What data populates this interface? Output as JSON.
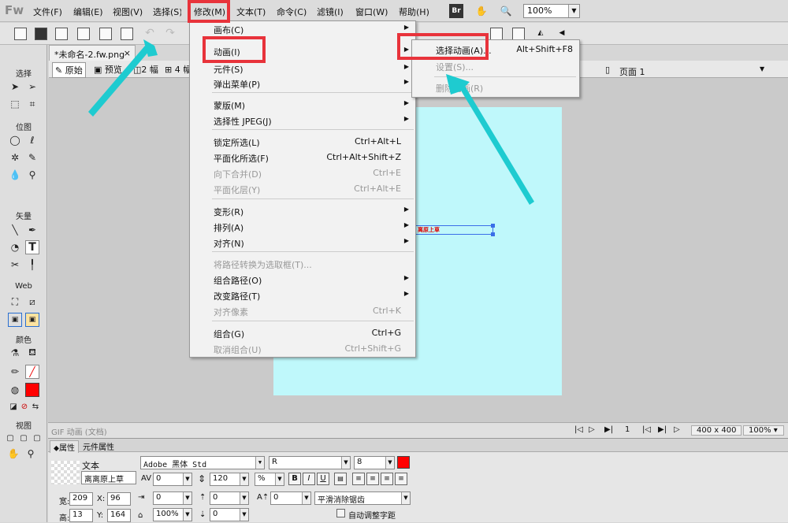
{
  "app": {
    "logo": "Fw"
  },
  "menubar": {
    "items": [
      "文件(F)",
      "编辑(E)",
      "视图(V)",
      "选择(S)",
      "修改(M)",
      "文本(T)",
      "命令(C)",
      "滤镜(I)",
      "窗口(W)",
      "帮助(H)"
    ],
    "br_label": "Br",
    "zoom": "100%"
  },
  "document": {
    "tab_title": "*未命名-2.fw.png",
    "tab_close": "×",
    "view_tabs": [
      "原始",
      "预览",
      "2 幅",
      "4 幅"
    ],
    "page_label": "页面 1",
    "canvas_text": "离原上草"
  },
  "tools": {
    "groups": [
      "选择",
      "位图",
      "矢量",
      "Web",
      "颜色",
      "视图"
    ]
  },
  "modify_menu": {
    "items": [
      {
        "label": "画布(C)",
        "shortcut": "",
        "submenu": true,
        "disabled": false
      },
      {
        "label": "动画(I)",
        "shortcut": "",
        "submenu": true,
        "disabled": false
      },
      {
        "label": "元件(S)",
        "shortcut": "",
        "submenu": true,
        "disabled": false
      },
      {
        "label": "弹出菜单(P)",
        "shortcut": "",
        "submenu": true,
        "disabled": false
      },
      {
        "label": "蒙版(M)",
        "shortcut": "",
        "submenu": true,
        "disabled": false
      },
      {
        "label": "选择性 JPEG(J)",
        "shortcut": "",
        "submenu": true,
        "disabled": false
      },
      {
        "label": "锁定所选(L)",
        "shortcut": "Ctrl+Alt+L",
        "submenu": false,
        "disabled": false
      },
      {
        "label": "平面化所选(F)",
        "shortcut": "Ctrl+Alt+Shift+Z",
        "submenu": false,
        "disabled": false
      },
      {
        "label": "向下合并(D)",
        "shortcut": "Ctrl+E",
        "submenu": false,
        "disabled": true
      },
      {
        "label": "平面化层(Y)",
        "shortcut": "Ctrl+Alt+E",
        "submenu": false,
        "disabled": true
      },
      {
        "label": "变形(R)",
        "shortcut": "",
        "submenu": true,
        "disabled": false
      },
      {
        "label": "排列(A)",
        "shortcut": "",
        "submenu": true,
        "disabled": false
      },
      {
        "label": "对齐(N)",
        "shortcut": "",
        "submenu": true,
        "disabled": false
      },
      {
        "label": "将路径转换为选取框(T)...",
        "shortcut": "",
        "submenu": false,
        "disabled": true
      },
      {
        "label": "组合路径(O)",
        "shortcut": "",
        "submenu": true,
        "disabled": false
      },
      {
        "label": "改变路径(T)",
        "shortcut": "",
        "submenu": true,
        "disabled": false
      },
      {
        "label": "对齐像素",
        "shortcut": "Ctrl+K",
        "submenu": false,
        "disabled": true
      },
      {
        "label": "组合(G)",
        "shortcut": "Ctrl+G",
        "submenu": false,
        "disabled": false
      },
      {
        "label": "取消组合(U)",
        "shortcut": "Ctrl+Shift+G",
        "submenu": false,
        "disabled": true
      }
    ]
  },
  "animation_menu": {
    "items": [
      {
        "label": "选择动画(A)...",
        "shortcut": "Alt+Shift+F8",
        "disabled": false
      },
      {
        "label": "设置(S)...",
        "shortcut": "",
        "disabled": true
      },
      {
        "label": "删除动画(R)",
        "shortcut": "",
        "disabled": true
      }
    ]
  },
  "status": {
    "mode": "GIF 动画 (文档)",
    "frame": "1",
    "size": "400 x 400",
    "zoom": "100%"
  },
  "properties": {
    "tabs": [
      "属性",
      "元件属性"
    ],
    "type_label": "文本",
    "object_name": "离离原上草",
    "font": "Adobe 黑体 Std",
    "style": "R",
    "size": "8",
    "kerning": "0",
    "leading": "120",
    "leading_unit": "%",
    "bold": "B",
    "italic": "I",
    "underline": "U",
    "indent1": "0",
    "indent2": "0",
    "baseline": "0",
    "antialias": "平滑消除锯齿",
    "w_label": "宽:",
    "w": "209",
    "x_label": "X:",
    "x": "96",
    "h_label": "高:",
    "h": "13",
    "y_label": "Y:",
    "y": "164",
    "scale": "100%",
    "space": "0",
    "auto_kern": "自动调整字距",
    "text_color": "#ff0000"
  },
  "colors": {
    "highlight": "#e8333b",
    "arrow": "#1ecbd0",
    "canvas": "#bff8fb"
  }
}
